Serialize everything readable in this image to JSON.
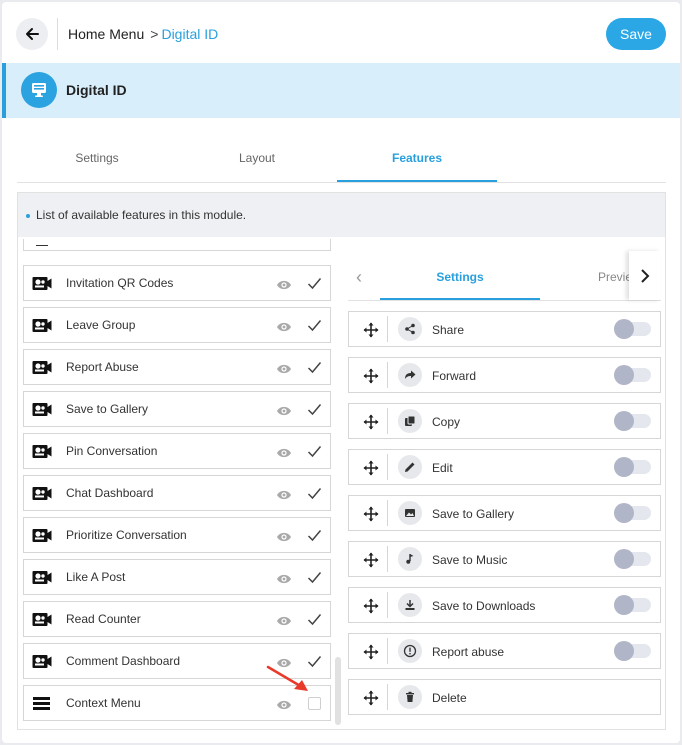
{
  "header": {
    "breadcrumb_root": "Home Menu",
    "breadcrumb_sep": ">",
    "breadcrumb_current": "Digital ID",
    "save_label": "Save",
    "back_icon": "arrow-left-icon"
  },
  "module": {
    "title": "Digital ID",
    "icon": "monitor-icon"
  },
  "tabs": [
    {
      "label": "Settings",
      "active": false
    },
    {
      "label": "Layout",
      "active": false
    },
    {
      "label": "Features",
      "active": true
    }
  ],
  "info": {
    "text": "List of available features in this module."
  },
  "features_list": [
    {
      "label": "Invitation QR Codes",
      "icon": "video-camera-icon",
      "enabled": true
    },
    {
      "label": "Leave Group",
      "icon": "video-camera-icon",
      "enabled": true
    },
    {
      "label": "Report Abuse",
      "icon": "video-camera-icon",
      "enabled": true
    },
    {
      "label": "Save to Gallery",
      "icon": "video-camera-icon",
      "enabled": true
    },
    {
      "label": "Pin Conversation",
      "icon": "video-camera-icon",
      "enabled": true
    },
    {
      "label": "Chat Dashboard",
      "icon": "video-camera-icon",
      "enabled": true
    },
    {
      "label": "Prioritize Conversation",
      "icon": "video-camera-icon",
      "enabled": true
    },
    {
      "label": "Like A Post",
      "icon": "video-camera-icon",
      "enabled": true
    },
    {
      "label": "Read Counter",
      "icon": "video-camera-icon",
      "enabled": true
    },
    {
      "label": "Comment Dashboard",
      "icon": "video-camera-icon",
      "enabled": true
    },
    {
      "label": "Context Menu",
      "icon": "menu-bars-icon",
      "enabled": false
    }
  ],
  "sub_tabs": {
    "active": "Settings",
    "next": "Preview"
  },
  "context_menu_items": [
    {
      "label": "Share",
      "icon": "share-icon",
      "on": false
    },
    {
      "label": "Forward",
      "icon": "forward-icon",
      "on": false
    },
    {
      "label": "Copy",
      "icon": "copy-icon",
      "on": false
    },
    {
      "label": "Edit",
      "icon": "pencil-icon",
      "on": false
    },
    {
      "label": "Save to Gallery",
      "icon": "image-icon",
      "on": false
    },
    {
      "label": "Save to Music",
      "icon": "music-note-icon",
      "on": false
    },
    {
      "label": "Save to Downloads",
      "icon": "download-icon",
      "on": false
    },
    {
      "label": "Report abuse",
      "icon": "alert-circle-icon",
      "on": false
    },
    {
      "label": "Delete",
      "icon": "trash-icon",
      "on": null
    }
  ],
  "colors": {
    "accent": "#29a0dd",
    "banner_bg": "#d8eefa",
    "annotation_arrow": "#e8392a"
  }
}
